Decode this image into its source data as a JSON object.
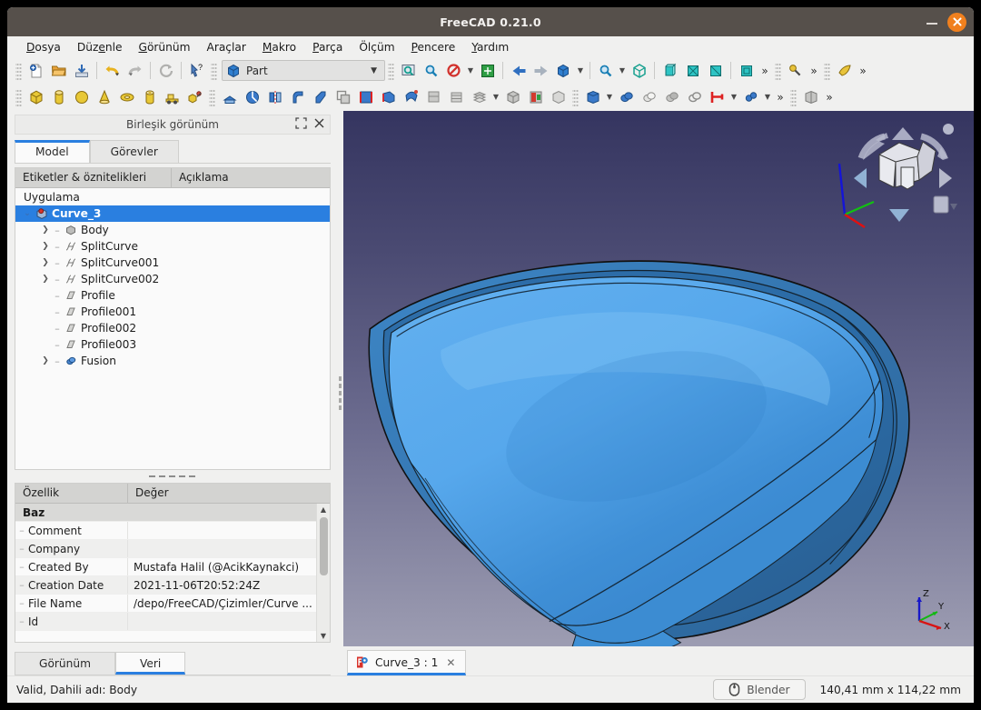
{
  "window": {
    "title": "FreeCAD 0.21.0",
    "minimize_icon": "minimize-icon",
    "close_icon": "close-icon"
  },
  "menubar": [
    {
      "label": "Dosya"
    },
    {
      "label": "Düzenle"
    },
    {
      "label": "Görünüm"
    },
    {
      "label": "Araçlar"
    },
    {
      "label": "Makro"
    },
    {
      "label": "Parça"
    },
    {
      "label": "Ölçüm"
    },
    {
      "label": "Pencere"
    },
    {
      "label": "Yardım"
    }
  ],
  "toolbar": {
    "workbench": {
      "value": "Part",
      "icon": "part-cube-icon",
      "dropdown_icon": "chevron-down-icon"
    },
    "overflow_label": "»"
  },
  "left_panel": {
    "header": {
      "title": "Birleşik görünüm",
      "float_icon": "undock-icon",
      "close_icon": "close-icon"
    },
    "tabs": [
      {
        "label": "Model",
        "active": true
      },
      {
        "label": "Görevler",
        "active": false
      }
    ],
    "tree": {
      "columns": [
        "Etiketler & öznitelikleri",
        "Açıklama"
      ],
      "root": "Uygulama",
      "items": [
        {
          "label": "Curve_3",
          "level": 1,
          "expander": "down",
          "icon": "document-icon",
          "selected": true
        },
        {
          "label": "Body",
          "level": 2,
          "expander": "right",
          "icon": "body-icon",
          "selected": false
        },
        {
          "label": "SplitCurve",
          "level": 2,
          "expander": "right",
          "icon": "splitcurve-icon",
          "selected": false
        },
        {
          "label": "SplitCurve001",
          "level": 2,
          "expander": "right",
          "icon": "splitcurve-icon",
          "selected": false
        },
        {
          "label": "SplitCurve002",
          "level": 2,
          "expander": "right",
          "icon": "splitcurve-icon",
          "selected": false
        },
        {
          "label": "Profile",
          "level": 2,
          "expander": "none",
          "icon": "profile-icon",
          "selected": false
        },
        {
          "label": "Profile001",
          "level": 2,
          "expander": "none",
          "icon": "profile-icon",
          "selected": false
        },
        {
          "label": "Profile002",
          "level": 2,
          "expander": "none",
          "icon": "profile-icon",
          "selected": false
        },
        {
          "label": "Profile003",
          "level": 2,
          "expander": "none",
          "icon": "profile-icon",
          "selected": false
        },
        {
          "label": "Fusion",
          "level": 2,
          "expander": "right",
          "icon": "fusion-icon",
          "selected": false
        }
      ]
    },
    "properties": {
      "columns": [
        "Özellik",
        "Değer"
      ],
      "group": "Baz",
      "rows": [
        {
          "key": "Comment",
          "value": ""
        },
        {
          "key": "Company",
          "value": ""
        },
        {
          "key": "Created By",
          "value": "Mustafa Halil (@AcikKaynakci)"
        },
        {
          "key": "Creation Date",
          "value": "2021-11-06T20:52:24Z"
        },
        {
          "key": "File Name",
          "value": "/depo/FreeCAD/Çizimler/Curve ..."
        },
        {
          "key": "Id",
          "value": ""
        }
      ]
    },
    "bottom_tabs": [
      {
        "label": "Görünüm",
        "active": false
      },
      {
        "label": "Veri",
        "active": true
      }
    ]
  },
  "document_tabs": [
    {
      "label": "Curve_3 : 1",
      "icon": "freecad-doc-icon",
      "close_icon": "close-icon",
      "active": true
    }
  ],
  "viewport": {
    "axis": {
      "z": "Z",
      "y": "Y",
      "x": "X"
    },
    "background_top": "#353560",
    "background_bottom": "#9d9db2",
    "model_color": "#4ea3e8"
  },
  "statusbar": {
    "message": "Valid, Dahili adı: Body",
    "nav_button": {
      "label": "Blender",
      "icon": "mouse-icon"
    },
    "dimensions": "140,41 mm x 114,22 mm"
  }
}
